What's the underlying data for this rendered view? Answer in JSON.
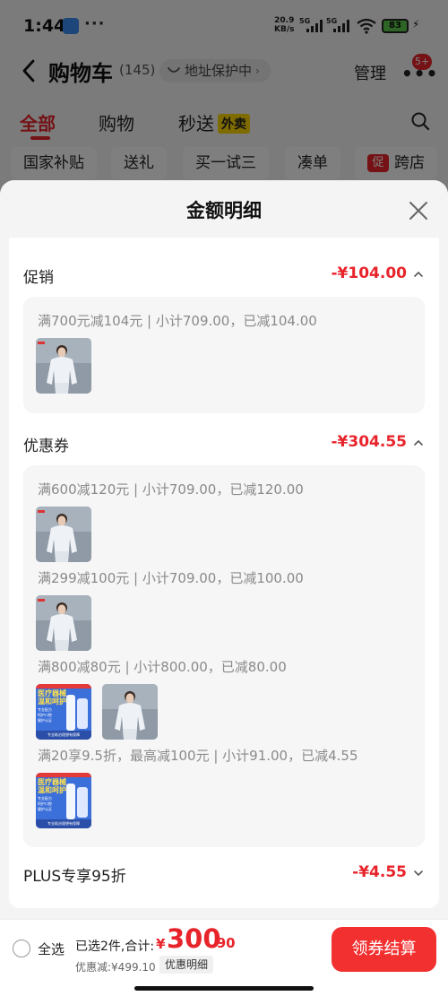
{
  "status_bar": {
    "time": "1:44",
    "dots": "···",
    "speed_value": "20.9",
    "speed_unit": "KB/s",
    "net1": "5G",
    "net2": "5G",
    "battery": "83"
  },
  "nav": {
    "title": "购物车",
    "count": "(145)",
    "address_protection": "地址保护中",
    "manage": "管理",
    "more_badge": "5+"
  },
  "tabs": {
    "all": "全部",
    "shopping": "购物",
    "instant": "秒送",
    "instant_tag": "外卖"
  },
  "filters": {
    "items": [
      "国家补贴",
      "送礼",
      "买一试三",
      "凑单",
      "跨店"
    ],
    "promo_icon": "促"
  },
  "sheet": {
    "title": "金额明细",
    "promo": {
      "label": "促销",
      "amount": "-¥104.00",
      "rules": [
        "满700元减104元 | 小计709.00，已减104.00"
      ]
    },
    "coupons": {
      "label": "优惠券",
      "amount": "-¥304.55",
      "rules": [
        "满600减120元 | 小计709.00，已减120.00",
        "满299减100元 | 小计709.00，已减100.00",
        "满800减80元 | 小计800.00，已减80.00",
        "满20享9.5折，最高减100元 | 小计91.00，已减4.55"
      ]
    },
    "plus": {
      "label": "PLUS专享95折",
      "amount": "-¥4.55"
    },
    "product_card_text": {
      "title_line1": "医疗器械",
      "title_line2": "温和呵护",
      "pill1": "专业配方",
      "pill2": "呵护口腔",
      "pill3": "健护认证",
      "footer": "专业助治理想有保障"
    }
  },
  "bottom": {
    "select_all": "全选",
    "summary_label": "已选2件,合计:",
    "currency": "¥",
    "total_int": "300",
    "total_dec": ".90",
    "discount": "优惠减:¥499.10",
    "detail_button": "优惠明细",
    "checkout": "领券结算"
  },
  "colors": {
    "accent_red": "#e8242b",
    "checkout_red": "#f23030",
    "tag_yellow": "#ffd900"
  }
}
